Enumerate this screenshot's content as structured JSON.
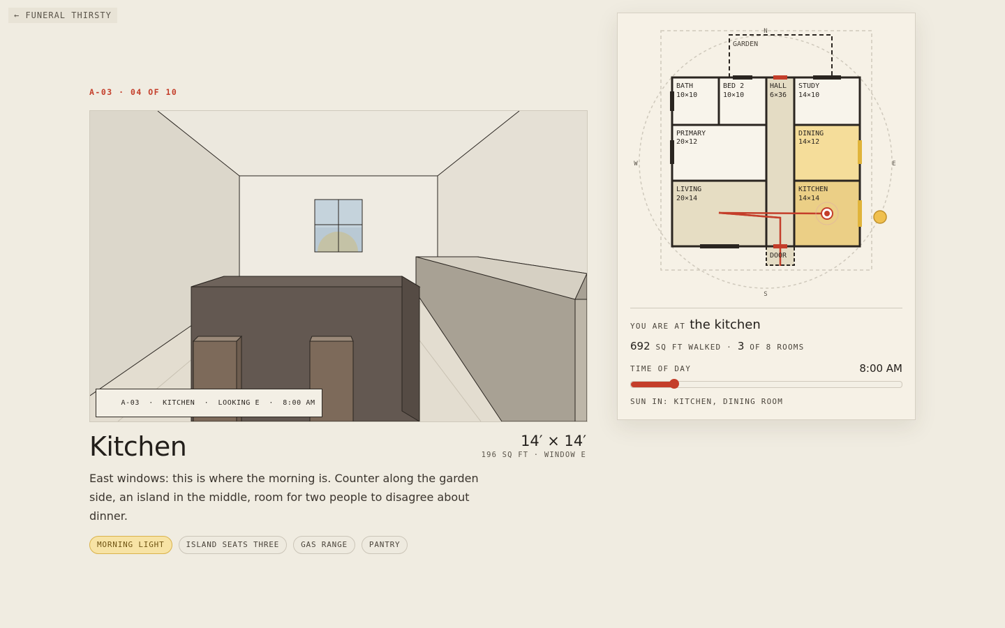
{
  "nav": {
    "back_label": "← FUNERAL THIRSTY"
  },
  "eyebrow": "A-03 · 04 OF 10",
  "view": {
    "caption": [
      "A-03",
      "KITCHEN",
      "LOOKING E",
      "8:00 AM"
    ]
  },
  "room": {
    "title": "Kitchen",
    "dims": "14′ × 14′",
    "dims_sub": "196 SQ FT · WINDOW E",
    "description": "East windows: this is where the morning is. Counter along the garden side, an island in the middle, room for two people to disagree about dinner.",
    "tags": [
      {
        "label": "MORNING LIGHT",
        "highlight": true
      },
      {
        "label": "ISLAND SEATS THREE",
        "highlight": false
      },
      {
        "label": "GAS RANGE",
        "highlight": false
      },
      {
        "label": "PANTRY",
        "highlight": false
      }
    ]
  },
  "plan": {
    "compass": {
      "n": "N",
      "s": "S",
      "e": "E",
      "w": "W"
    },
    "rooms": {
      "garden": {
        "name": "GARDEN"
      },
      "bath": {
        "name": "BATH",
        "size": "10×10"
      },
      "bed2": {
        "name": "BED 2",
        "size": "10×10"
      },
      "hall": {
        "name": "HALL",
        "size": "6×36"
      },
      "study": {
        "name": "STUDY",
        "size": "14×10"
      },
      "primary": {
        "name": "PRIMARY",
        "size": "20×12"
      },
      "dining": {
        "name": "DINING",
        "size": "14×12"
      },
      "living": {
        "name": "LIVING",
        "size": "20×14"
      },
      "kitchen": {
        "name": "KITCHEN",
        "size": "14×14"
      },
      "door": {
        "name": "DOOR"
      }
    },
    "colors": {
      "sun": "#f5dd9a",
      "sun_strong": "#ebcf86",
      "walked": "#e4dcc4",
      "path": "#c43e2a"
    }
  },
  "status": {
    "you_are_at_label": "YOU ARE AT",
    "you_are_at": "the kitchen",
    "walked_value": "692",
    "walked_label": "SQ FT WALKED ·",
    "rooms_value": "3",
    "rooms_label": "OF 8 ROOMS",
    "tod_label": "TIME OF DAY",
    "tod_time": "8:00 AM",
    "tod_fraction": 0.16,
    "sun_in": "SUN IN: KITCHEN, DINING ROOM"
  }
}
